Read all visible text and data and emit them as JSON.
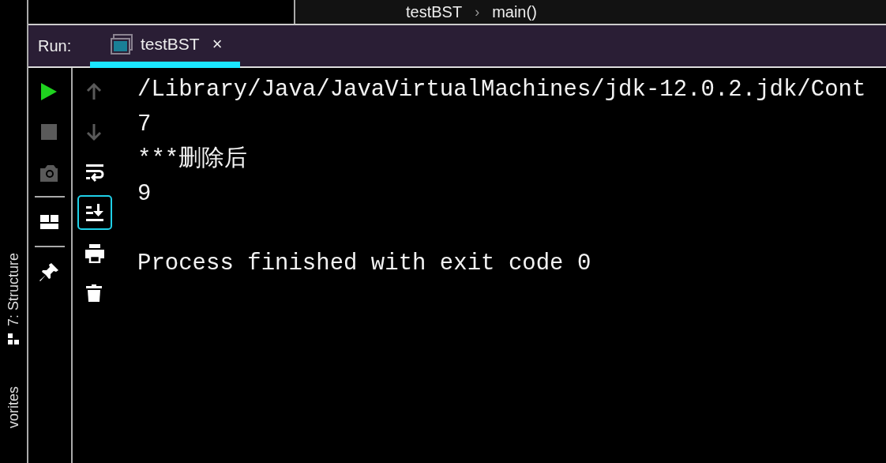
{
  "side_tabs": [
    {
      "kind": "structure",
      "label": "7: Structure"
    },
    {
      "kind": "favorites",
      "label": "vorites"
    }
  ],
  "breadcrumb": {
    "items": [
      "testBST",
      "main()"
    ],
    "separator": "›"
  },
  "run_panel": {
    "label": "Run:",
    "tabs": [
      {
        "label": "testBST",
        "close": "×",
        "selected": true
      }
    ]
  },
  "run_toolbar": [
    {
      "kind": "run",
      "disabled": false
    },
    {
      "kind": "stop",
      "disabled": true
    },
    {
      "kind": "camera",
      "disabled": true
    },
    {
      "kind": "separator"
    },
    {
      "kind": "layout",
      "disabled": false
    },
    {
      "kind": "separator"
    },
    {
      "kind": "pin",
      "disabled": false
    }
  ],
  "console_toolbar": [
    {
      "kind": "up",
      "disabled": true,
      "selected": false
    },
    {
      "kind": "down",
      "disabled": true,
      "selected": false
    },
    {
      "kind": "wrap",
      "disabled": false,
      "selected": false
    },
    {
      "kind": "scroll-end",
      "disabled": false,
      "selected": true
    },
    {
      "kind": "print",
      "disabled": false,
      "selected": false
    },
    {
      "kind": "trash",
      "disabled": false,
      "selected": false
    }
  ],
  "console": {
    "output": [
      "/Library/Java/JavaVirtualMachines/jdk-12.0.2.jdk/Cont",
      "7",
      "***删除后",
      "9"
    ],
    "exit_message": "Process finished with exit code 0"
  }
}
